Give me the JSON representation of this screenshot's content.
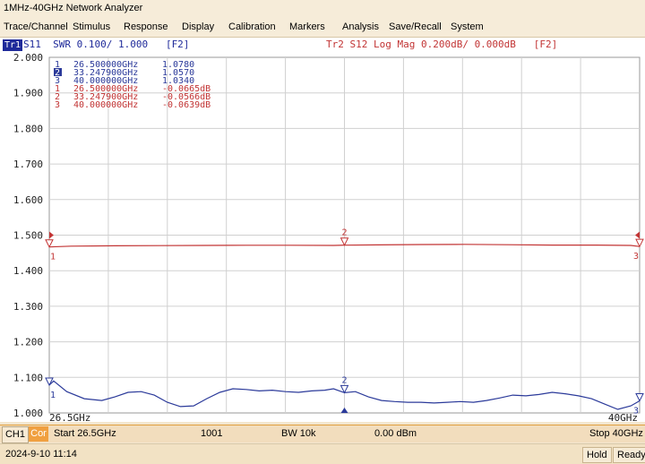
{
  "app": {
    "title": "1MHz-40GHz Network Analyzer"
  },
  "menu": [
    "Trace/Channel",
    "Stimulus",
    "Response",
    "Display",
    "Calibration",
    "Markers",
    "Analysis",
    "Save/Recall",
    "System"
  ],
  "trace_header": {
    "tr1_badge": "Tr1",
    "tr1_text": "S11  SWR 0.100/ 1.000   [F2]",
    "tr2_text": "Tr2 S12 Log Mag 0.200dB/ 0.000dB   [F2]"
  },
  "axis": {
    "y_ticks": [
      "2.000",
      "1.900",
      "1.800",
      "1.700",
      "1.600",
      "1.500",
      "1.400",
      "1.300",
      "1.200",
      "1.100",
      "1.000"
    ],
    "x_start_label": "26.5GHz",
    "x_stop_label": "40GHz"
  },
  "markers": {
    "tr1": [
      {
        "num": "1",
        "freq": "26.500000GHz",
        "value": "1.0780",
        "active": false
      },
      {
        "num": "2",
        "freq": "33.247900GHz",
        "value": "1.0570",
        "active": true
      },
      {
        "num": "3",
        "freq": "40.000000GHz",
        "value": "1.0340",
        "active": false
      }
    ],
    "tr2": [
      {
        "num": "1",
        "freq": "26.500000GHz",
        "value": "-0.0665dB"
      },
      {
        "num": "2",
        "freq": "33.247900GHz",
        "value": "-0.0566dB"
      },
      {
        "num": "3",
        "freq": "40.000000GHz",
        "value": "-0.0639dB"
      }
    ],
    "on_trace_labels": {
      "m1": "1",
      "m2": "2",
      "m3": "3"
    }
  },
  "chart_data": {
    "type": "line",
    "xlabel": "",
    "ylabel": "",
    "xlim": [
      26.5,
      40.0
    ],
    "ylim": [
      1.0,
      2.0
    ],
    "x_unit": "GHz",
    "grid": true,
    "series": [
      {
        "name": "S11 SWR",
        "color": "#2b3a9a",
        "x": [
          26.5,
          26.6,
          26.9,
          27.3,
          27.7,
          28.0,
          28.3,
          28.6,
          28.9,
          29.2,
          29.5,
          29.8,
          30.1,
          30.4,
          30.7,
          31.0,
          31.3,
          31.6,
          31.9,
          32.2,
          32.5,
          32.8,
          33.0,
          33.25,
          33.5,
          33.8,
          34.1,
          34.4,
          34.7,
          35.0,
          35.3,
          35.6,
          35.9,
          36.2,
          36.5,
          36.8,
          37.1,
          37.4,
          37.7,
          38.0,
          38.3,
          38.6,
          38.9,
          39.2,
          39.5,
          39.8,
          40.0
        ],
        "values": [
          1.078,
          1.09,
          1.06,
          1.04,
          1.035,
          1.045,
          1.058,
          1.06,
          1.05,
          1.03,
          1.018,
          1.02,
          1.04,
          1.058,
          1.068,
          1.066,
          1.062,
          1.064,
          1.06,
          1.058,
          1.062,
          1.064,
          1.068,
          1.057,
          1.06,
          1.045,
          1.035,
          1.032,
          1.03,
          1.03,
          1.028,
          1.03,
          1.032,
          1.03,
          1.035,
          1.042,
          1.05,
          1.048,
          1.052,
          1.058,
          1.054,
          1.048,
          1.04,
          1.025,
          1.01,
          1.02,
          1.034
        ]
      },
      {
        "name": "S12 Log Mag",
        "color": "#c23434",
        "unit": "dB",
        "x": [
          26.5,
          27.0,
          28.0,
          29.0,
          30.0,
          31.0,
          32.0,
          33.0,
          33.25,
          34.0,
          35.0,
          36.0,
          37.0,
          38.0,
          39.0,
          39.8,
          40.0
        ],
        "values": [
          -0.0665,
          -0.062,
          -0.06,
          -0.059,
          -0.058,
          -0.057,
          -0.057,
          -0.058,
          -0.0566,
          -0.055,
          -0.053,
          -0.052,
          -0.054,
          -0.056,
          -0.056,
          -0.058,
          -0.0639
        ]
      }
    ]
  },
  "bottom_bar": {
    "channel": "CH1",
    "cor": "Cor",
    "start": "Start 26.5GHz",
    "points": "1001",
    "bw": "BW 10k",
    "power": "0.00 dBm",
    "stop": "Stop 40GHz"
  },
  "status_bar": {
    "datetime": "2024-9-10 11:14",
    "hold": "Hold",
    "ready": "Ready"
  },
  "colors": {
    "tr1": "#2b3a9a",
    "tr2": "#c23434",
    "accent": "#f0a040"
  }
}
